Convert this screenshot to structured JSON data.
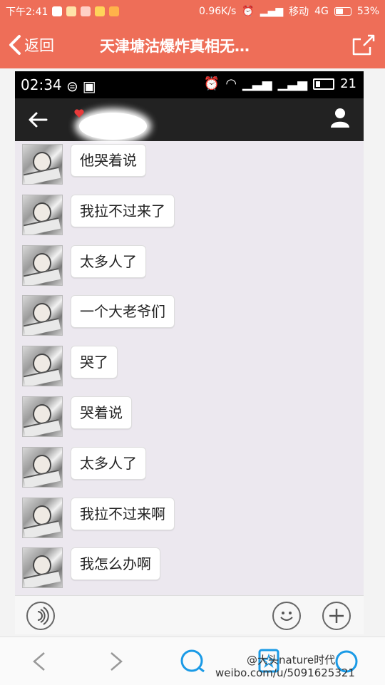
{
  "status_bar": {
    "time": "下午2:41",
    "speed": "0.96K/s",
    "carrier": "移动",
    "network": "4G",
    "battery": "53%"
  },
  "title_bar": {
    "back_label": "返回",
    "title": "天津塘沽爆炸真相无…"
  },
  "screenshot": {
    "status": {
      "time": "02:34",
      "signal_text": "21"
    },
    "messages": [
      {
        "text": "他哭着说"
      },
      {
        "text": "我拉不过来了"
      },
      {
        "text": "太多人了"
      },
      {
        "text": "一个大老爷们"
      },
      {
        "text": "哭了"
      },
      {
        "text": "哭着说"
      },
      {
        "text": "太多人了"
      },
      {
        "text": "我拉不过来啊"
      },
      {
        "text": "我怎么办啊"
      }
    ]
  },
  "watermark": {
    "line1": "@大头nature时代",
    "line2": "weibo.com/u/5091625321"
  },
  "colors": {
    "accent": "#ee6e58",
    "bottom_icon": "#1a9ae6"
  }
}
